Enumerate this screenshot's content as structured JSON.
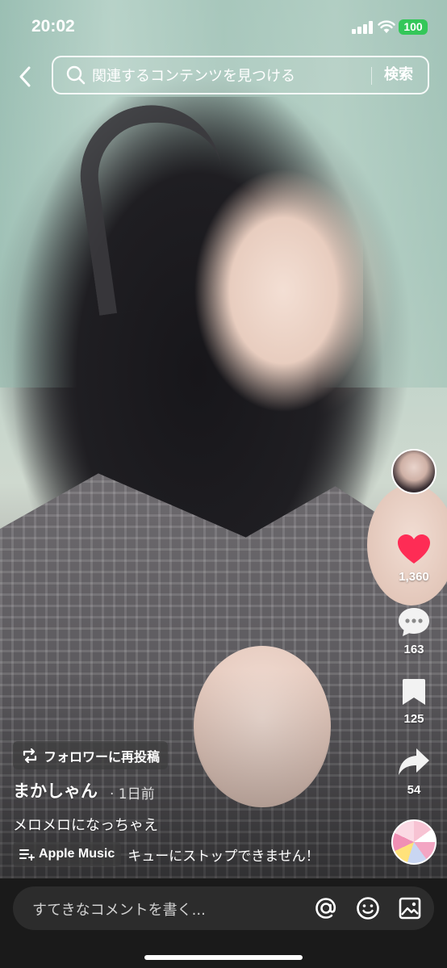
{
  "status_bar": {
    "time": "20:02",
    "battery": "100"
  },
  "search": {
    "placeholder": "関連するコンテンツを見つける",
    "button": "検索"
  },
  "rail": {
    "likes": "1,360",
    "comments": "163",
    "saves": "125",
    "shares": "54"
  },
  "post": {
    "repost_label": "フォロワーに再投稿",
    "author": "まかしゃん",
    "age": "· 1日前",
    "caption": "メロメロになっちゃえ",
    "music_chip": "Apple Music",
    "music_text": "キューにストップできません！"
  },
  "comment_bar": {
    "placeholder": "すてきなコメントを書く..."
  },
  "colors": {
    "like": "#fe2c55",
    "battery": "#34c759",
    "bottom_bar": "#1a1a1a"
  }
}
